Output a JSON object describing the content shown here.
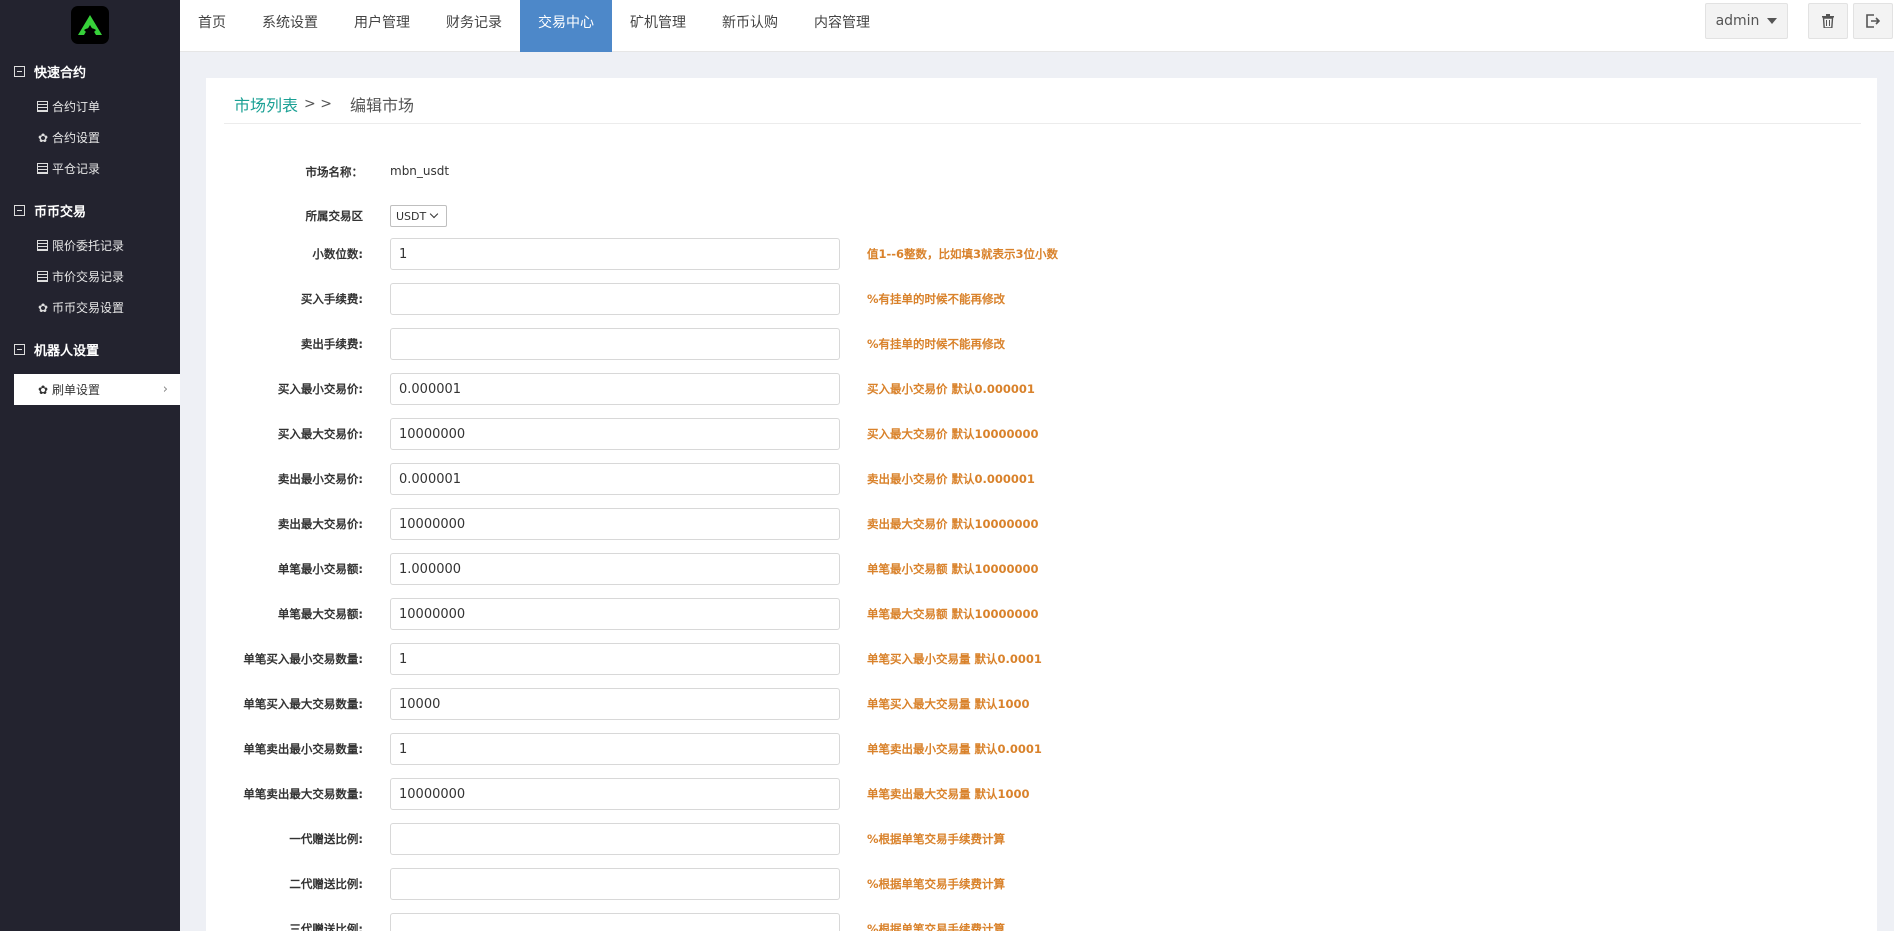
{
  "sidebar": {
    "groups": [
      {
        "title": "快速合约",
        "items": [
          {
            "label": "合约订单",
            "icon": "ledger-icon"
          },
          {
            "label": "合约设置",
            "icon": "gear-icon"
          },
          {
            "label": "平仓记录",
            "icon": "ledger-icon"
          }
        ]
      },
      {
        "title": "币币交易",
        "items": [
          {
            "label": "限价委托记录",
            "icon": "ledger-icon"
          },
          {
            "label": "市价交易记录",
            "icon": "ledger-icon"
          },
          {
            "label": "币币交易设置",
            "icon": "gear-icon"
          }
        ]
      },
      {
        "title": "机器人设置",
        "items": [
          {
            "label": "刷单设置",
            "icon": "gear-icon",
            "active": true
          }
        ]
      }
    ]
  },
  "topnav": {
    "tabs": [
      "首页",
      "系统设置",
      "用户管理",
      "财务记录",
      "交易中心",
      "矿机管理",
      "新币认购",
      "内容管理"
    ],
    "active_tab": "交易中心",
    "user": "admin"
  },
  "breadcrumb": {
    "parent": "市场列表",
    "separator": "> >",
    "current": "编辑市场"
  },
  "form": {
    "market_name": {
      "label": "市场名称：",
      "value": "mbn_usdt"
    },
    "zone": {
      "label": "所属交易区",
      "selected": "USDT"
    },
    "fields": [
      {
        "label": "小数位数:",
        "value": "1",
        "hint": "值1--6整数，比如填3就表示3位小数"
      },
      {
        "label": "买入手续费:",
        "value": "",
        "hint": "%有挂单的时候不能再修改"
      },
      {
        "label": "卖出手续费:",
        "value": "",
        "hint": "%有挂单的时候不能再修改"
      },
      {
        "label": "买入最小交易价:",
        "value": "0.000001",
        "hint": "买入最小交易价 默认0.000001"
      },
      {
        "label": "买入最大交易价:",
        "value": "10000000",
        "hint": "买入最大交易价 默认10000000"
      },
      {
        "label": "卖出最小交易价:",
        "value": "0.000001",
        "hint": "卖出最小交易价 默认0.000001"
      },
      {
        "label": "卖出最大交易价:",
        "value": "10000000",
        "hint": "卖出最大交易价 默认10000000"
      },
      {
        "label": "单笔最小交易额:",
        "value": "1.000000",
        "hint": "单笔最小交易额 默认10000000"
      },
      {
        "label": "单笔最大交易额:",
        "value": "10000000",
        "hint": "单笔最大交易额 默认10000000"
      },
      {
        "label": "单笔买入最小交易数量:",
        "value": "1",
        "hint": "单笔买入最小交易量 默认0.0001"
      },
      {
        "label": "单笔买入最大交易数量:",
        "value": "10000",
        "hint": "单笔买入最大交易量 默认1000"
      },
      {
        "label": "单笔卖出最小交易数量:",
        "value": "1",
        "hint": "单笔卖出最小交易量 默认0.0001"
      },
      {
        "label": "单笔卖出最大交易数量:",
        "value": "10000000",
        "hint": "单笔卖出最大交易量 默认1000"
      },
      {
        "label": "一代赠送比例:",
        "value": "",
        "hint": "%根据单笔交易手续费计算"
      },
      {
        "label": "二代赠送比例:",
        "value": "",
        "hint": "%根据单笔交易手续费计算"
      },
      {
        "label": "三代赠送比例:",
        "value": "",
        "hint": "%根据单笔交易手续费计算"
      }
    ]
  },
  "colors": {
    "sidebar_bg": "#23232f",
    "active_tab": "#4d88c9",
    "link": "#1aa094",
    "hint": "#d9822b",
    "logo_green": "#37d13a"
  }
}
